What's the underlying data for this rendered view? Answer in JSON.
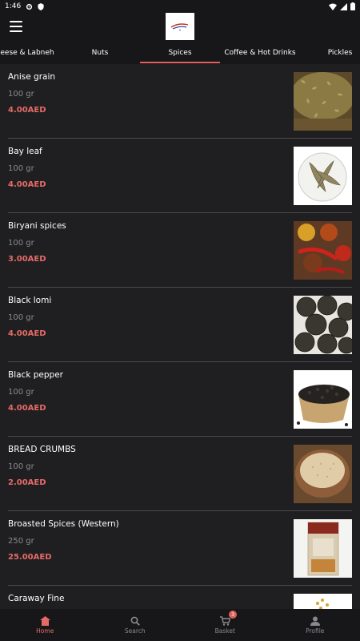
{
  "status": {
    "time": "1:46"
  },
  "tabs": [
    {
      "label": "Cheese & Labneh"
    },
    {
      "label": "Nuts"
    },
    {
      "label": "Spices",
      "active": true
    },
    {
      "label": "Coffee & Hot Drinks"
    },
    {
      "label": "Pickles"
    }
  ],
  "products": [
    {
      "name": "Anise grain",
      "weight": "100 gr",
      "price": "4.00AED",
      "icon": "anise-grain-image"
    },
    {
      "name": "Bay leaf",
      "weight": "100 gr",
      "price": "4.00AED",
      "icon": "bay-leaf-image"
    },
    {
      "name": "Biryani spices",
      "weight": "100 gr",
      "price": "3.00AED",
      "icon": "biryani-spices-image"
    },
    {
      "name": "Black lomi",
      "weight": "100 gr",
      "price": "4.00AED",
      "icon": "black-lomi-image"
    },
    {
      "name": "Black pepper",
      "weight": "100 gr",
      "price": "4.00AED",
      "icon": "black-pepper-image"
    },
    {
      "name": "BREAD CRUMBS",
      "weight": "100 gr",
      "price": "2.00AED",
      "icon": "bread-crumbs-image"
    },
    {
      "name": "Broasted Spices (Western)",
      "weight": "250 gr",
      "price": "25.00AED",
      "icon": "broasted-spices-image"
    },
    {
      "name": "Caraway Fine",
      "weight": "",
      "price": "",
      "icon": "caraway-image"
    }
  ],
  "nav": {
    "home": "Home",
    "search": "Search",
    "basket": "Basket",
    "basket_count": "3",
    "profile": "Profile"
  },
  "colors": {
    "accent": "#e0605c",
    "background": "#1f1f21",
    "bar": "#17171a"
  }
}
